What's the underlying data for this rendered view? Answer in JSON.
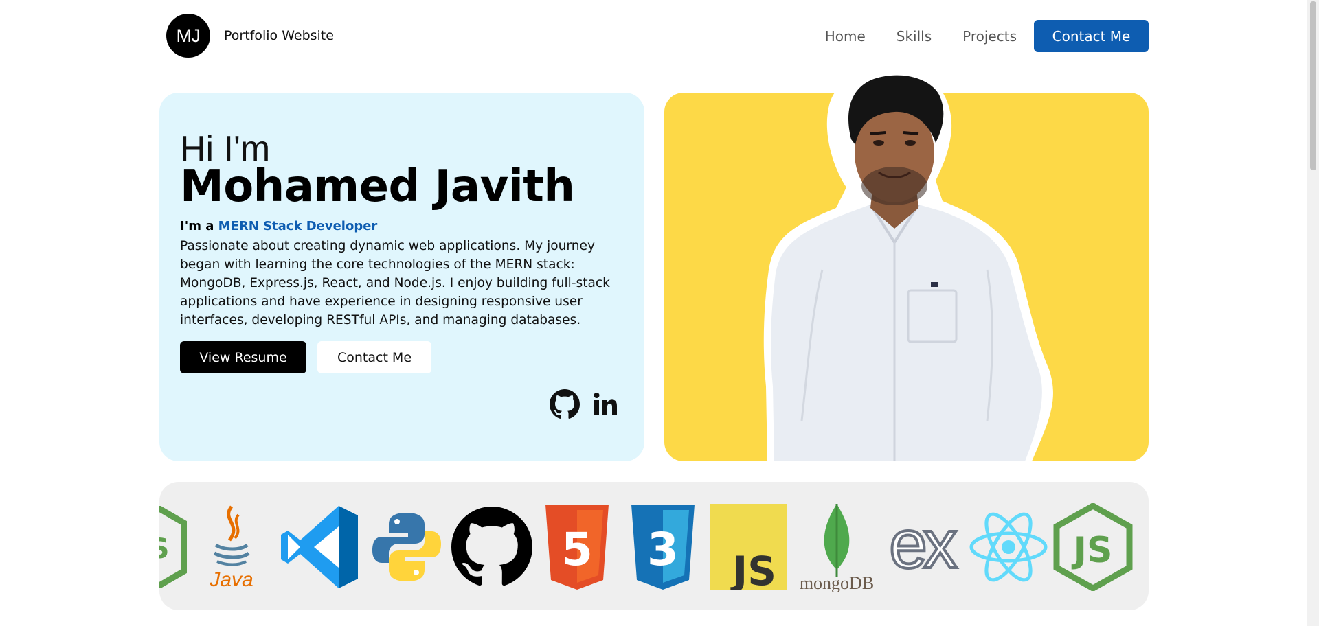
{
  "header": {
    "logo_text": "MJ",
    "site_title": "Portfolio Website",
    "nav": [
      {
        "label": "Home"
      },
      {
        "label": "Skills"
      },
      {
        "label": "Projects"
      }
    ],
    "cta_label": "Contact Me"
  },
  "hero": {
    "greeting": "Hi I'm",
    "name": "Mohamed Javith",
    "role_prefix": "I'm a",
    "role": "MERN Stack Developer",
    "bio": "Passionate about creating dynamic web applications. My journey began with learning the core technologies of the MERN stack: MongoDB, Express.js, React, and Node.js. I enjoy building full-stack applications and have experience in designing responsive user interfaces, developing RESTful APIs, and managing databases.",
    "resume_button": "View Resume",
    "contact_button": "Contact Me",
    "social": [
      {
        "icon": "github-icon"
      },
      {
        "icon": "linkedin-icon",
        "text": "in"
      }
    ]
  },
  "photo": {
    "background_color": "#fdd947"
  },
  "skills": {
    "items": [
      {
        "icon": "nodejs-partial-icon"
      },
      {
        "icon": "java-icon",
        "label": "Java"
      },
      {
        "icon": "vscode-icon"
      },
      {
        "icon": "python-icon"
      },
      {
        "icon": "github-icon"
      },
      {
        "icon": "html5-icon",
        "label": "5"
      },
      {
        "icon": "css3-icon",
        "label": "3"
      },
      {
        "icon": "javascript-icon",
        "label": "JS"
      },
      {
        "icon": "mongodb-icon",
        "label": "mongoDB"
      },
      {
        "icon": "express-icon",
        "label": "ex"
      },
      {
        "icon": "react-icon"
      },
      {
        "icon": "nodejs-icon",
        "label": "JS"
      }
    ]
  },
  "colors": {
    "accent": "#0e5db1",
    "hero_bg": "#e0f6fd",
    "strip_bg": "#efefef"
  }
}
